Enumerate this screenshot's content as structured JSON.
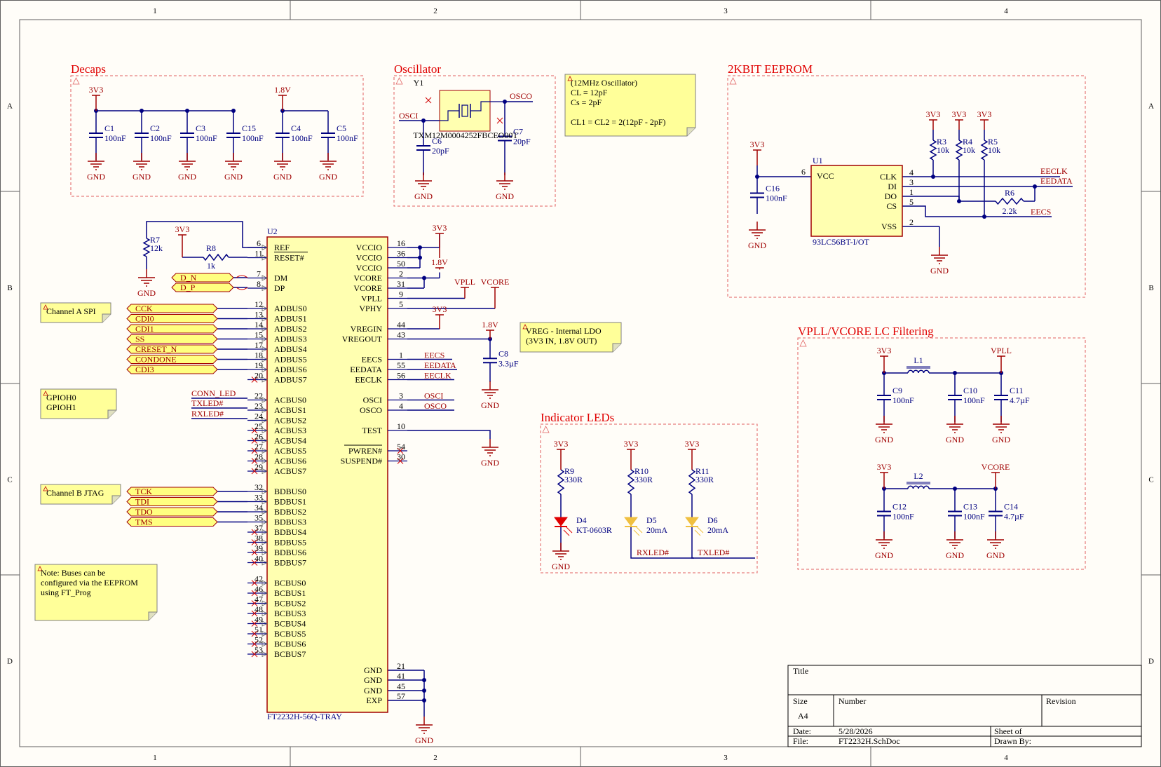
{
  "frame": {
    "columns": [
      "1",
      "2",
      "3",
      "4"
    ],
    "rows": [
      "A",
      "B",
      "C",
      "D"
    ]
  },
  "sections": {
    "decaps": "Decaps",
    "oscillator": "Oscillator",
    "eeprom": "2KBIT EEPROM",
    "lc": "VPLL/VCORE LC Filtering",
    "leds": "Indicator LEDs"
  },
  "notes": {
    "osc": [
      "(12MHz Oscillator)",
      "CL = 12pF",
      "Cs = 2pF",
      "",
      "CL1 = CL2 = 2(12pF - 2pF)"
    ],
    "spi": [
      "Channel A SPI"
    ],
    "gpio": [
      "GPIOH0",
      "GPIOH1"
    ],
    "jtag": [
      "Channel B JTAG"
    ],
    "bus": [
      "Note: Buses can be",
      "configured via the EEPROM",
      "using FT_Prog"
    ],
    "vreg": [
      "VREG - Internal LDO",
      "(3V3 IN, 1.8V OUT)"
    ]
  },
  "labels": {
    "v3v3": "3V3",
    "v18": "1.8V",
    "gnd": "GND",
    "vpll": "VPLL",
    "vcore": "VCORE",
    "osci": "OSCI",
    "osco": "OSCO",
    "eecs": "EECS",
    "eedata": "EEDATA",
    "eeclk": "EECLK",
    "conn_led": "CONN_LED",
    "txled": "TXLED#",
    "rxled": "RXLED#"
  },
  "decaps": [
    {
      "ref": "C1",
      "val": "100nF"
    },
    {
      "ref": "C2",
      "val": "100nF"
    },
    {
      "ref": "C3",
      "val": "100nF"
    },
    {
      "ref": "C15",
      "val": "100nF"
    },
    {
      "ref": "C4",
      "val": "100nF"
    },
    {
      "ref": "C5",
      "val": "100nF"
    }
  ],
  "osc": {
    "ref": "Y1",
    "part": "TXM12M0004252FBCEO00T",
    "c6": {
      "ref": "C6",
      "val": "20pF"
    },
    "c7": {
      "ref": "C7",
      "val": "20pF"
    }
  },
  "eeprom": {
    "ref": "U1",
    "part": "93LC56BT-I/OT",
    "vcc_pin": "6",
    "vss_pin": "2",
    "left_pins": [
      "VCC"
    ],
    "right_pins": [
      {
        "name": "CLK",
        "num": "4"
      },
      {
        "name": "DI",
        "num": "3"
      },
      {
        "name": "DO",
        "num": "1"
      },
      {
        "name": "CS",
        "num": "5"
      },
      {
        "name": "VSS",
        "num": "2"
      }
    ],
    "r3": {
      "ref": "R3",
      "val": "10k"
    },
    "r4": {
      "ref": "R4",
      "val": "10k"
    },
    "r5": {
      "ref": "R5",
      "val": "10k"
    },
    "r6": {
      "ref": "R6",
      "val": "2.2k"
    },
    "c16": {
      "ref": "C16",
      "val": "100nF"
    }
  },
  "u2": {
    "ref": "U2",
    "part": "FT2232H-56Q-TRAY",
    "left": [
      {
        "n": "REF",
        "p": "6"
      },
      {
        "n": "RESET#",
        "p": "11"
      },
      {
        "n": "",
        "p": ""
      },
      {
        "n": "DM",
        "p": "7"
      },
      {
        "n": "DP",
        "p": "8"
      },
      {
        "n": "",
        "p": ""
      },
      {
        "n": "ADBUS0",
        "p": "12"
      },
      {
        "n": "ADBUS1",
        "p": "13"
      },
      {
        "n": "ADBUS2",
        "p": "14"
      },
      {
        "n": "ADBUS3",
        "p": "15"
      },
      {
        "n": "ADBUS4",
        "p": "17"
      },
      {
        "n": "ADBUS5",
        "p": "18"
      },
      {
        "n": "ADBUS6",
        "p": "19"
      },
      {
        "n": "ADBUS7",
        "p": "20"
      },
      {
        "n": "",
        "p": ""
      },
      {
        "n": "ACBUS0",
        "p": "22"
      },
      {
        "n": "ACBUS1",
        "p": "23"
      },
      {
        "n": "ACBUS2",
        "p": "24"
      },
      {
        "n": "ACBUS3",
        "p": "25"
      },
      {
        "n": "ACBUS4",
        "p": "26"
      },
      {
        "n": "ACBUS5",
        "p": "27"
      },
      {
        "n": "ACBUS6",
        "p": "28"
      },
      {
        "n": "ACBUS7",
        "p": "29"
      },
      {
        "n": "",
        "p": ""
      },
      {
        "n": "BDBUS0",
        "p": "32"
      },
      {
        "n": "BDBUS1",
        "p": "33"
      },
      {
        "n": "BDBUS2",
        "p": "34"
      },
      {
        "n": "BDBUS3",
        "p": "35"
      },
      {
        "n": "BDBUS4",
        "p": "37"
      },
      {
        "n": "BDBUS5",
        "p": "38"
      },
      {
        "n": "BDBUS6",
        "p": "39"
      },
      {
        "n": "BDBUS7",
        "p": "40"
      },
      {
        "n": "",
        "p": ""
      },
      {
        "n": "BCBUS0",
        "p": "42"
      },
      {
        "n": "BCBUS1",
        "p": "46"
      },
      {
        "n": "BCBUS2",
        "p": "47"
      },
      {
        "n": "BCBUS3",
        "p": "48"
      },
      {
        "n": "BCBUS4",
        "p": "49"
      },
      {
        "n": "BCBUS5",
        "p": "51"
      },
      {
        "n": "BCBUS6",
        "p": "52"
      },
      {
        "n": "BCBUS7",
        "p": "53"
      }
    ],
    "right": [
      {
        "n": "VCCIO",
        "p": "16"
      },
      {
        "n": "VCCIO",
        "p": "36"
      },
      {
        "n": "VCCIO",
        "p": "50"
      },
      {
        "n": "VCORE",
        "p": "2"
      },
      {
        "n": "VCORE",
        "p": "31"
      },
      {
        "n": "VPLL",
        "p": "9"
      },
      {
        "n": "VPHY",
        "p": "5"
      },
      {
        "n": "",
        "p": ""
      },
      {
        "n": "VREGIN",
        "p": "44"
      },
      {
        "n": "VREGOUT",
        "p": "43"
      },
      {
        "n": "",
        "p": ""
      },
      {
        "n": "EECS",
        "p": "1"
      },
      {
        "n": "EEDATA",
        "p": "55"
      },
      {
        "n": "EECLK",
        "p": "56"
      },
      {
        "n": "",
        "p": ""
      },
      {
        "n": "OSCI",
        "p": "3"
      },
      {
        "n": "OSCO",
        "p": "4"
      },
      {
        "n": "",
        "p": ""
      },
      {
        "n": "TEST",
        "p": "10"
      },
      {
        "n": "",
        "p": ""
      },
      {
        "n": "PWREN#",
        "p": "54"
      },
      {
        "n": "SUSPEND#",
        "p": "30"
      }
    ],
    "gnd_pins": [
      {
        "n": "GND",
        "p": "21"
      },
      {
        "n": "GND",
        "p": "41"
      },
      {
        "n": "GND",
        "p": "45"
      },
      {
        "n": "EXP",
        "p": "57"
      }
    ]
  },
  "r7": {
    "ref": "R7",
    "val": "12k"
  },
  "r8": {
    "ref": "R8",
    "val": "1k"
  },
  "c8": {
    "ref": "C8",
    "val": "3.3µF"
  },
  "usb_ports": [
    "D_N",
    "D_P"
  ],
  "spi_ports": [
    "CCK",
    "CDI0",
    "CDI1",
    "SS",
    "CRESET_N",
    "CONDONE",
    "CDI3"
  ],
  "jtag_ports": [
    "TCK",
    "TDI",
    "TDO",
    "TMS"
  ],
  "leds": [
    {
      "r": "R9",
      "rv": "330R",
      "d": "D4",
      "dv": "KT-0603R",
      "net": ""
    },
    {
      "r": "R10",
      "rv": "330R",
      "d": "D5",
      "dv": "20mA",
      "net": "RXLED#"
    },
    {
      "r": "R11",
      "rv": "330R",
      "d": "D6",
      "dv": "20mA",
      "net": "TXLED#"
    }
  ],
  "lc": {
    "l1": "L1",
    "l2": "L2",
    "c9": {
      "ref": "C9",
      "val": "100nF"
    },
    "c10": {
      "ref": "C10",
      "val": "100nF"
    },
    "c11": {
      "ref": "C11",
      "val": "4.7µF"
    },
    "c12": {
      "ref": "C12",
      "val": "100nF"
    },
    "c13": {
      "ref": "C13",
      "val": "100nF"
    },
    "c14": {
      "ref": "C14",
      "val": "4.7µF"
    }
  },
  "title_block": {
    "title": "Title",
    "size": "Size",
    "size_val": "A4",
    "number": "Number",
    "revision": "Revision",
    "date": "Date:",
    "date_val": "5/28/2026",
    "file": "File:",
    "file_val": "FT2232H.SchDoc",
    "sheet": "Sheet  of",
    "drawn": "Drawn By:"
  },
  "colors": {
    "wire": "#000080",
    "part": "#a00000",
    "body": "#ffffb0",
    "title": "#e00000",
    "power": "#a00000"
  }
}
